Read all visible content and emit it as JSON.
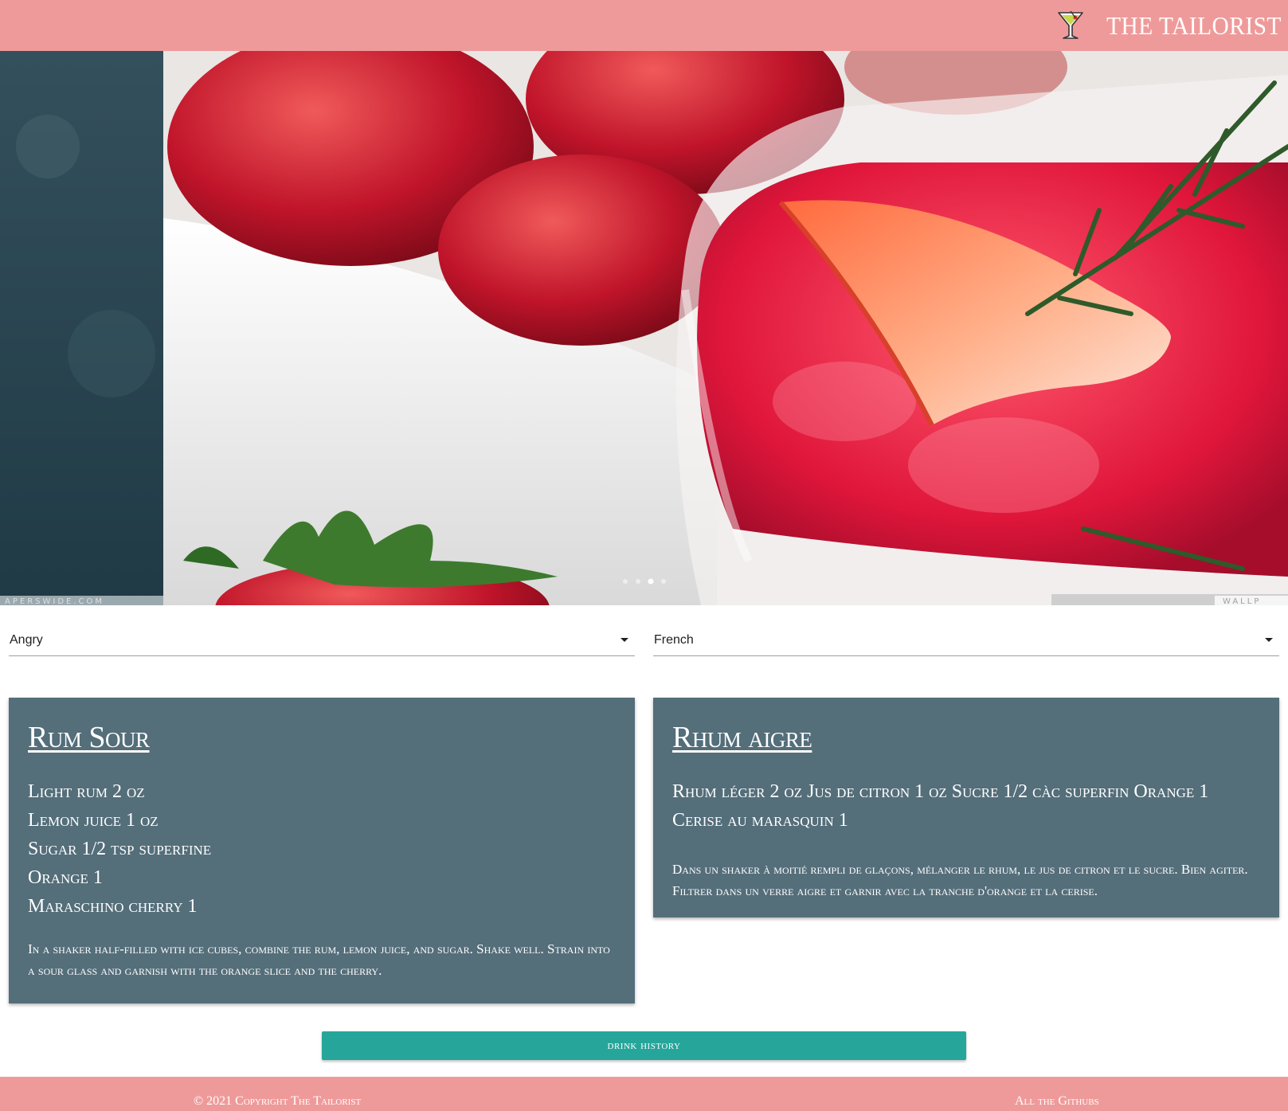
{
  "header": {
    "brand_text": "THE TAILORIST",
    "brand_icon": "cocktail-glass-icon"
  },
  "hero": {
    "image": "strawberry-cocktail-photo",
    "watermark_left": "APERSWIDE.COM",
    "watermark_right": "WALLP"
  },
  "filters": {
    "mood": {
      "value": "Angry"
    },
    "language": {
      "value": "French"
    }
  },
  "cards": {
    "english": {
      "title": "Rum Sour",
      "ingredients": [
        "Light rum 2 oz",
        "Lemon juice 1 oz",
        "Sugar 1/2 tsp superfine",
        "Orange 1",
        "Maraschino cherry 1"
      ],
      "instructions": "In a shaker half-filled with ice cubes, combine the rum, lemon juice, and sugar. Shake well. Strain into a sour glass and garnish with the orange slice and the cherry."
    },
    "french": {
      "title": "Rhum aigre",
      "ingredients_text": "Rhum léger 2 oz Jus de citron 1 oz Sucre 1/2 càc superfin Orange 1 Cerise au marasquin 1",
      "instructions": "Dans un shaker à moitié rempli de glaçons, mélanger le rhum, le jus de citron et le sucre. Bien agiter. Filtrer dans un verre aigre et garnir avec la tranche d'orange et la cerise."
    }
  },
  "actions": {
    "drink_history_label": "drink history"
  },
  "footer": {
    "copyright": "© 2021 Copyright The Tailorist",
    "github_link": "All the Githubs"
  },
  "colors": {
    "header_bg": "#ef9a9a",
    "card_bg": "#546e7a",
    "button_bg": "#26a69a"
  }
}
